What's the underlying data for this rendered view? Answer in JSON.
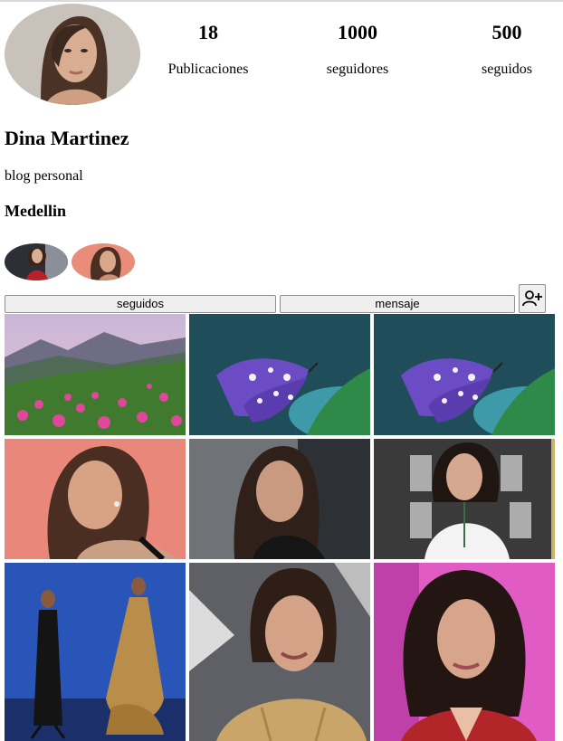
{
  "profile": {
    "name": "Dina Martinez",
    "bio": "blog personal",
    "city": "Medellin"
  },
  "stats": [
    {
      "value": "18",
      "label": "Publicaciones"
    },
    {
      "value": "1000",
      "label": "seguidores"
    },
    {
      "value": "500",
      "label": "seguidos"
    }
  ],
  "actions": {
    "following_label": "seguidos",
    "message_label": "mensaje",
    "add_user_icon": "person-plus-icon"
  },
  "posts": [
    "landscape-flowers-photo",
    "butterfly-photo",
    "butterfly-photo",
    "portrait-photo",
    "portrait-photo",
    "portrait-photo",
    "runway-photo",
    "portrait-photo",
    "portrait-photo"
  ]
}
